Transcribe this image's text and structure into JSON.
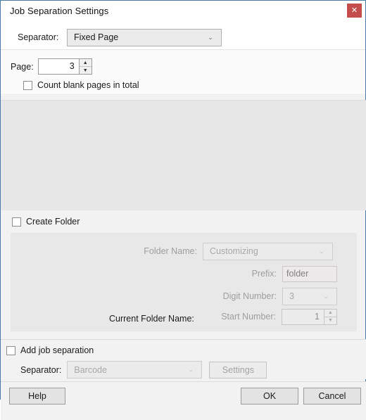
{
  "window": {
    "title": "Job Separation Settings",
    "close_label": "✕",
    "accent_border": "#4a7ba6",
    "close_button_color": "#c44d4d"
  },
  "separator_section": {
    "label": "Separator:",
    "value": "Fixed Page",
    "chevron": "⌄"
  },
  "fixed_page_section": {
    "page_label": "Page:",
    "page_value": "3",
    "spin_up": "▲",
    "spin_down": "▼",
    "count_blank_label": "Count blank pages in total",
    "count_blank_checked": false
  },
  "create_folder_section": {
    "checkbox_label": "Create Folder",
    "checked": false,
    "folder_name_label": "Folder Name:",
    "folder_name_value": "Customizing",
    "prefix_label": "Prefix:",
    "prefix_value": "folder",
    "digit_number_label": "Digit Number:",
    "digit_number_value": "3",
    "start_number_label": "Start Number:",
    "start_number_value": "1",
    "current_folder_label": "Current Folder Name:",
    "current_folder_value": "",
    "chevron": "⌄",
    "spin_up": "▲",
    "spin_down": "▼"
  },
  "add_job_separation_section": {
    "checkbox_label": "Add job separation",
    "checked": false,
    "separator_label": "Separator:",
    "separator_value": "Barcode",
    "settings_label": "Settings",
    "chevron": "⌄"
  },
  "footer": {
    "help_label": "Help",
    "ok_label": "OK",
    "cancel_label": "Cancel"
  }
}
